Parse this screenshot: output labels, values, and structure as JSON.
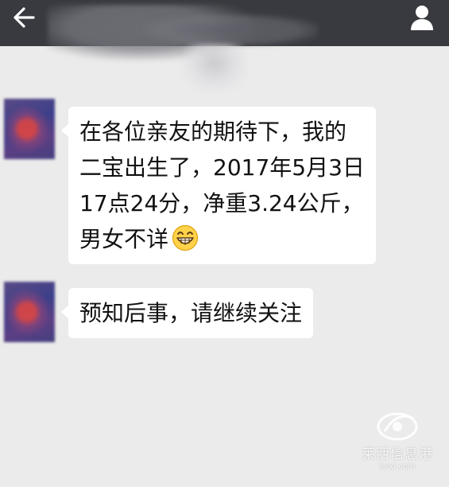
{
  "topbar": {
    "back_icon": "arrow-left-icon",
    "contact_icon": "person-icon"
  },
  "messages": [
    {
      "lines": [
        "在各位亲友的期待下，我的",
        "二宝出生了，2017年5月3日",
        "17点24分，净重3.24公斤，",
        "男女不详"
      ],
      "emoji": "grinning-face-icon"
    },
    {
      "lines": [
        "预知后事，请继续关注"
      ]
    }
  ],
  "watermark": {
    "text": "莱西信息港",
    "url": "laixi.com"
  },
  "colors": {
    "topbar": "#393a3f",
    "background": "#ebebeb",
    "bubble": "#ffffff"
  }
}
